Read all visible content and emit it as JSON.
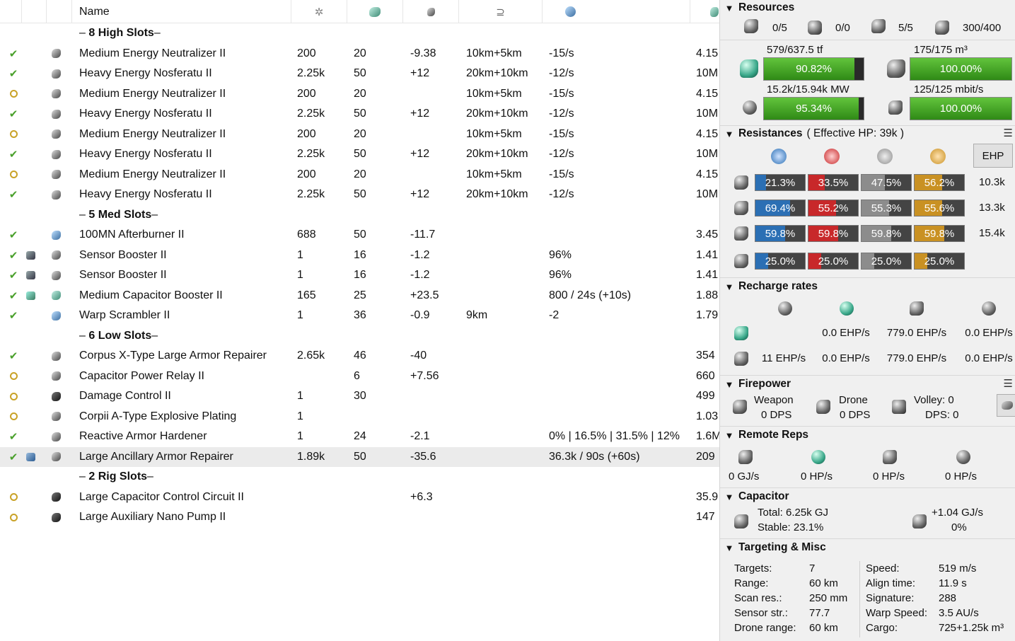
{
  "columns": {
    "name": "Name"
  },
  "sections": [
    {
      "count": "8",
      "label": "High Slots"
    },
    {
      "count": "5",
      "label": "Med Slots"
    },
    {
      "count": "6",
      "label": "Low Slots"
    },
    {
      "count": "2",
      "label": "Rig Slots"
    }
  ],
  "modules": [
    {
      "state": "active",
      "name": "Medium Energy Neutralizer II",
      "cpu": "200",
      "pg": "20",
      "cap": "-9.38",
      "range": "10km+5km",
      "misc": "-15/s",
      "price": "4.15"
    },
    {
      "state": "active",
      "name": "Heavy Energy Nosferatu II",
      "cpu": "2.25k",
      "pg": "50",
      "cap": "+12",
      "range": "20km+10km",
      "misc": "-12/s",
      "price": "10M"
    },
    {
      "state": "online",
      "name": "Medium Energy Neutralizer II",
      "cpu": "200",
      "pg": "20",
      "cap": "",
      "range": "10km+5km",
      "misc": "-15/s",
      "price": "4.15"
    },
    {
      "state": "active",
      "name": "Heavy Energy Nosferatu II",
      "cpu": "2.25k",
      "pg": "50",
      "cap": "+12",
      "range": "20km+10km",
      "misc": "-12/s",
      "price": "10M"
    },
    {
      "state": "online",
      "name": "Medium Energy Neutralizer II",
      "cpu": "200",
      "pg": "20",
      "cap": "",
      "range": "10km+5km",
      "misc": "-15/s",
      "price": "4.15"
    },
    {
      "state": "active",
      "name": "Heavy Energy Nosferatu II",
      "cpu": "2.25k",
      "pg": "50",
      "cap": "+12",
      "range": "20km+10km",
      "misc": "-12/s",
      "price": "10M"
    },
    {
      "state": "online",
      "name": "Medium Energy Neutralizer II",
      "cpu": "200",
      "pg": "20",
      "cap": "",
      "range": "10km+5km",
      "misc": "-15/s",
      "price": "4.15"
    },
    {
      "state": "active",
      "name": "Heavy Energy Nosferatu II",
      "cpu": "2.25k",
      "pg": "50",
      "cap": "+12",
      "range": "20km+10km",
      "misc": "-12/s",
      "price": "10M"
    },
    {
      "state": "active",
      "name": "100MN Afterburner II",
      "cpu": "688",
      "pg": "50",
      "cap": "-11.7",
      "range": "",
      "misc": "",
      "price": "3.45"
    },
    {
      "state": "active",
      "name": "Sensor Booster II",
      "cpu": "1",
      "pg": "16",
      "cap": "-1.2",
      "range": "",
      "misc": "96%",
      "price": "1.41"
    },
    {
      "state": "active",
      "name": "Sensor Booster II",
      "cpu": "1",
      "pg": "16",
      "cap": "-1.2",
      "range": "",
      "misc": "96%",
      "price": "1.41"
    },
    {
      "state": "active",
      "name": "Medium Capacitor Booster II",
      "cpu": "165",
      "pg": "25",
      "cap": "+23.5",
      "range": "",
      "misc": "800 / 24s (+10s)",
      "price": "1.88"
    },
    {
      "state": "active",
      "name": "Warp Scrambler II",
      "cpu": "1",
      "pg": "36",
      "cap": "-0.9",
      "range": "9km",
      "misc": "-2",
      "price": "1.79"
    },
    {
      "state": "active",
      "name": "Corpus X-Type Large Armor Repairer",
      "cpu": "2.65k",
      "pg": "46",
      "cap": "-40",
      "range": "",
      "misc": "",
      "price": "354"
    },
    {
      "state": "online",
      "name": "Capacitor Power Relay II",
      "cpu": "",
      "pg": "6",
      "cap": "+7.56",
      "range": "",
      "misc": "",
      "price": "660"
    },
    {
      "state": "online",
      "name": "Damage Control II",
      "cpu": "1",
      "pg": "30",
      "cap": "",
      "range": "",
      "misc": "",
      "price": "499"
    },
    {
      "state": "online",
      "name": "Corpii A-Type Explosive Plating",
      "cpu": "1",
      "pg": "",
      "cap": "",
      "range": "",
      "misc": "",
      "price": "1.03"
    },
    {
      "state": "active",
      "name": "Reactive Armor Hardener",
      "cpu": "1",
      "pg": "24",
      "cap": "-2.1",
      "range": "",
      "misc": "0% | 16.5% | 31.5% | 12%",
      "price": "1.6M"
    },
    {
      "state": "active",
      "name": "Large Ancillary Armor Repairer",
      "cpu": "1.89k",
      "pg": "50",
      "cap": "-35.6",
      "range": "",
      "misc": "36.3k / 90s (+60s)",
      "price": "209"
    },
    {
      "state": "online",
      "name": "Large Capacitor Control Circuit II",
      "cpu": "",
      "pg": "",
      "cap": "+6.3",
      "range": "",
      "misc": "",
      "price": "35.9"
    },
    {
      "state": "online",
      "name": "Large Auxiliary Nano Pump II",
      "cpu": "",
      "pg": "",
      "cap": "",
      "range": "",
      "misc": "",
      "price": "147"
    }
  ],
  "resources": {
    "title": "Resources",
    "counts": [
      "0/5",
      "0/0",
      "5/5",
      "300/400"
    ],
    "cpu_label": "579/637.5 tf",
    "cpu_pct": "90.82%",
    "cpu_frac": 0.9082,
    "calib_label": "175/175 m³",
    "calib_pct": "100.00%",
    "calib_frac": 1.0,
    "pg_label": "15.2k/15.94k MW",
    "pg_pct": "95.34%",
    "pg_frac": 0.9534,
    "bw_label": "125/125 mbit/s",
    "bw_pct": "100.00%",
    "bw_frac": 1.0
  },
  "resistances": {
    "title": "Resistances",
    "ehp_note": "( Effective HP: 39k )",
    "ehp_button": "EHP",
    "menu": "☰",
    "rows": [
      {
        "vals": [
          "21.3%",
          "33.5%",
          "47.5%",
          "56.2%"
        ],
        "fracs": [
          0.213,
          0.335,
          0.475,
          0.562
        ],
        "hp": "10.3k"
      },
      {
        "vals": [
          "69.4%",
          "55.2%",
          "55.3%",
          "55.6%"
        ],
        "fracs": [
          0.694,
          0.552,
          0.553,
          0.556
        ],
        "hp": "13.3k"
      },
      {
        "vals": [
          "59.8%",
          "59.8%",
          "59.8%",
          "59.8%"
        ],
        "fracs": [
          0.598,
          0.598,
          0.598,
          0.598
        ],
        "hp": "15.4k"
      },
      {
        "vals": [
          "25.0%",
          "25.0%",
          "25.0%",
          "25.0%"
        ],
        "fracs": [
          0.25,
          0.25,
          0.25,
          0.25
        ],
        "hp": ""
      }
    ],
    "colors": [
      "#2b6fb4",
      "#c8282a",
      "#8c8c8c",
      "#c99123"
    ]
  },
  "recharge": {
    "title": "Recharge rates",
    "rows": [
      [
        "",
        "0.0 EHP/s",
        "779.0 EHP/s",
        "0.0 EHP/s"
      ],
      [
        "11 EHP/s",
        "0.0 EHP/s",
        "779.0 EHP/s",
        "0.0 EHP/s"
      ]
    ]
  },
  "firepower": {
    "title": "Firepower",
    "weapon": "Weapon",
    "weapon_dps": "0 DPS",
    "drone": "Drone",
    "drone_dps": "0 DPS",
    "volley": "Volley: 0",
    "dps": "DPS: 0",
    "menu": "☰"
  },
  "remote": {
    "title": "Remote Reps",
    "vals": [
      "0 GJ/s",
      "0 HP/s",
      "0 HP/s",
      "0 HP/s"
    ]
  },
  "capacitor": {
    "title": "Capacitor",
    "total": "Total: 6.25k GJ",
    "stable": "Stable: 23.1%",
    "rate": "+1.04 GJ/s",
    "rate_pct": "0%"
  },
  "targeting": {
    "title": "Targeting & Misc",
    "left": [
      [
        "Targets:",
        "7"
      ],
      [
        "Range:",
        "60 km"
      ],
      [
        "Scan res.:",
        "250 mm"
      ],
      [
        "Sensor str.:",
        "77.7"
      ],
      [
        "Drone range:",
        "60 km"
      ]
    ],
    "right": [
      [
        "Speed:",
        "519 m/s"
      ],
      [
        "Align time:",
        "11.9 s"
      ],
      [
        "Signature:",
        "288"
      ],
      [
        "Warp Speed:",
        "3.5 AU/s"
      ],
      [
        "Cargo:",
        "725+1.25k m³"
      ]
    ]
  }
}
